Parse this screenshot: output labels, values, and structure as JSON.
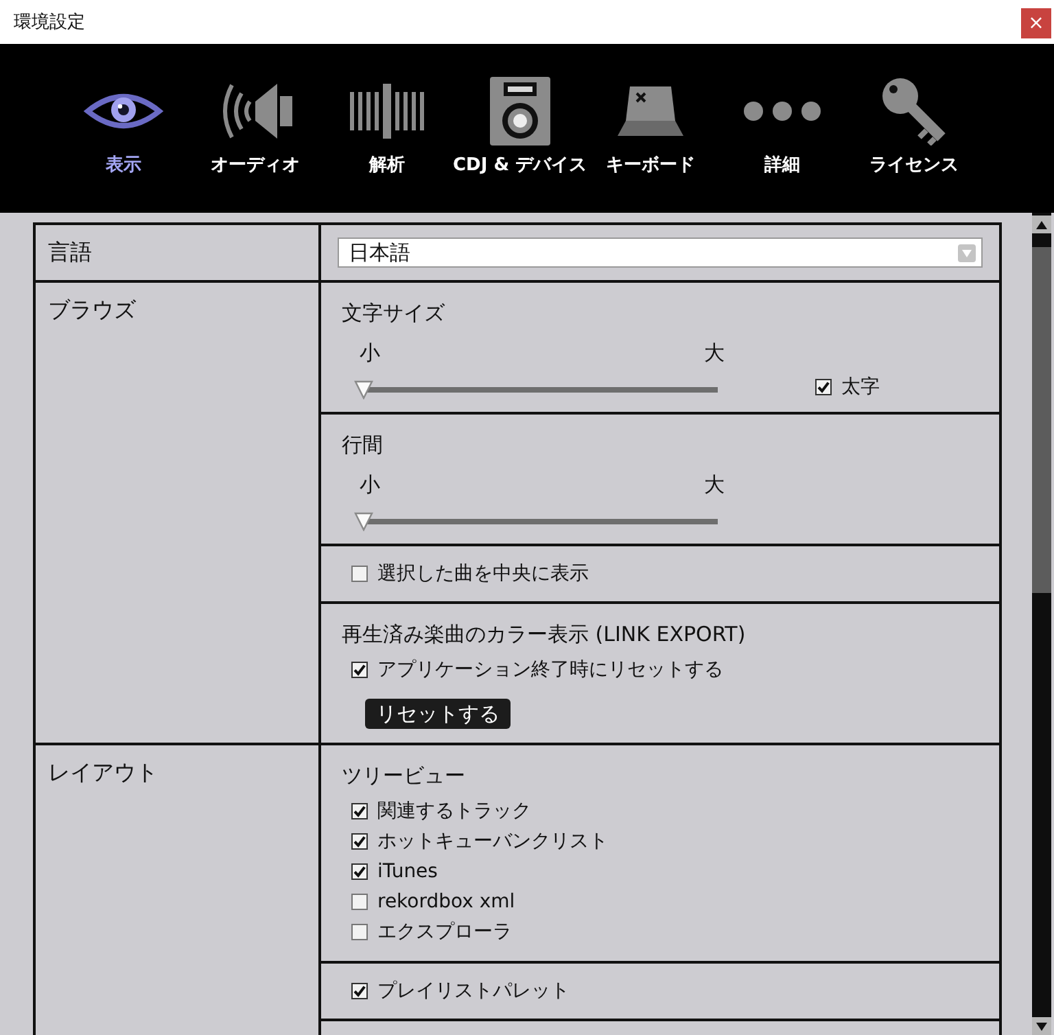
{
  "window": {
    "title": "環境設定",
    "close": "×"
  },
  "toolbar": [
    {
      "kind": "eye",
      "label": "表示",
      "selected": true
    },
    {
      "kind": "speaker",
      "label": "オーディオ",
      "selected": false
    },
    {
      "kind": "waveform",
      "label": "解析",
      "selected": false
    },
    {
      "kind": "device",
      "label": "CDJ & デバイス",
      "selected": false
    },
    {
      "kind": "keycap",
      "label": "キーボード",
      "selected": false
    },
    {
      "kind": "dots",
      "label": "詳細",
      "selected": false
    },
    {
      "kind": "key",
      "label": "ライセンス",
      "selected": false
    }
  ],
  "settings": [
    {
      "label": "言語",
      "cells": [
        {
          "kind": "dropdown",
          "value": "日本語"
        }
      ]
    },
    {
      "label": "ブラウズ",
      "cells": [
        {
          "kind": "slider",
          "title": "文字サイズ",
          "min_label": "小",
          "max_label": "大",
          "level": 0,
          "option": {
            "label": "太字",
            "checked": true
          }
        },
        {
          "kind": "slider",
          "title": "行間",
          "min_label": "小",
          "max_label": "大",
          "level": 0
        },
        {
          "kind": "options",
          "options": [
            {
              "label": "選択した曲を中央に表示",
              "checked": false
            }
          ]
        },
        {
          "kind": "options",
          "title": "再生済み楽曲のカラー表示 (LINK EXPORT)",
          "options": [
            {
              "label": "アプリケーション終了時にリセットする",
              "checked": true
            }
          ],
          "button": "リセットする"
        }
      ]
    },
    {
      "label": "レイアウト",
      "cells": [
        {
          "kind": "options",
          "title": "ツリービュー",
          "options": [
            {
              "label": "関連するトラック",
              "checked": true
            },
            {
              "label": "ホットキューバンクリスト",
              "checked": true
            },
            {
              "label": "iTunes",
              "checked": true
            },
            {
              "label": "rekordbox xml",
              "checked": false
            },
            {
              "label": "エクスプローラ",
              "checked": false
            }
          ]
        },
        {
          "kind": "options",
          "options": [
            {
              "label": "プレイリストパレット",
              "checked": true
            }
          ]
        }
      ]
    }
  ]
}
